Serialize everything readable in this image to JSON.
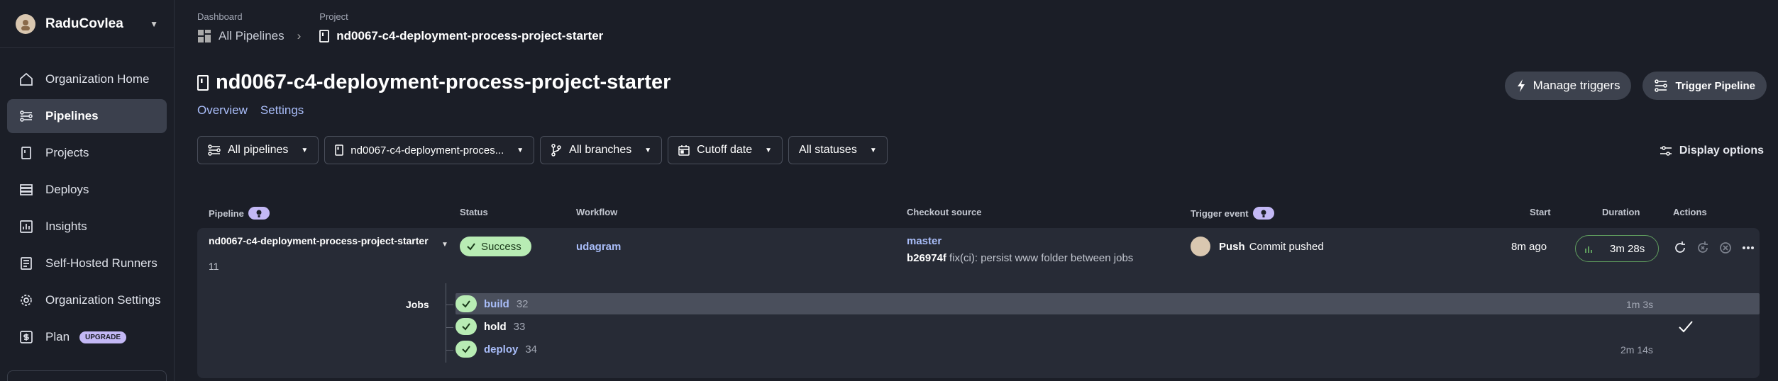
{
  "sidebar": {
    "org_name": "RaduCovlea",
    "items": [
      {
        "label": "Organization Home",
        "icon": "home-icon"
      },
      {
        "label": "Pipelines",
        "icon": "pipelines-icon",
        "active": true
      },
      {
        "label": "Projects",
        "icon": "projects-icon"
      },
      {
        "label": "Deploys",
        "icon": "deploys-icon"
      },
      {
        "label": "Insights",
        "icon": "insights-icon"
      },
      {
        "label": "Self-Hosted Runners",
        "icon": "runners-icon"
      },
      {
        "label": "Organization Settings",
        "icon": "gear-icon"
      },
      {
        "label": "Plan",
        "icon": "plan-icon",
        "badge": "UPGRADE"
      }
    ]
  },
  "breadcrumb": {
    "dashboard_label": "Dashboard",
    "dashboard_value": "All Pipelines",
    "project_label": "Project",
    "project_value": "nd0067-c4-deployment-process-project-starter"
  },
  "header": {
    "title": "nd0067-c4-deployment-process-project-starter",
    "tabs": [
      "Overview",
      "Settings"
    ],
    "manage_triggers": "Manage triggers",
    "trigger_pipeline": "Trigger Pipeline"
  },
  "filters": {
    "pipelines": "All pipelines",
    "project": "nd0067-c4-deployment-proces...",
    "branches": "All branches",
    "cutoff": "Cutoff date",
    "statuses": "All statuses",
    "display_options": "Display options"
  },
  "table": {
    "headers": {
      "pipeline": "Pipeline",
      "status": "Status",
      "workflow": "Workflow",
      "checkout": "Checkout source",
      "trigger": "Trigger event",
      "start": "Start",
      "duration": "Duration",
      "actions": "Actions"
    },
    "row": {
      "pipeline_name": "nd0067-c4-deployment-process-project-starter",
      "pipeline_number": "11",
      "status": "Success",
      "workflow": "udagram",
      "branch": "master",
      "commit_hash": "b26974f",
      "commit_msg": "fix(ci): persist www folder between jobs",
      "trigger_type": "Push",
      "trigger_desc": "Commit pushed",
      "start": "8m ago",
      "duration": "3m 28s",
      "jobs_label": "Jobs",
      "jobs": [
        {
          "name": "build",
          "number": "32",
          "duration": "1m 3s"
        },
        {
          "name": "hold",
          "number": "33",
          "duration": ""
        },
        {
          "name": "deploy",
          "number": "34",
          "duration": "2m 14s"
        }
      ]
    }
  },
  "colors": {
    "background": "#1b1e27",
    "accent_link": "#a9bdf9",
    "success": "#b8ecb4",
    "badge_purple": "#c3b8f5"
  }
}
